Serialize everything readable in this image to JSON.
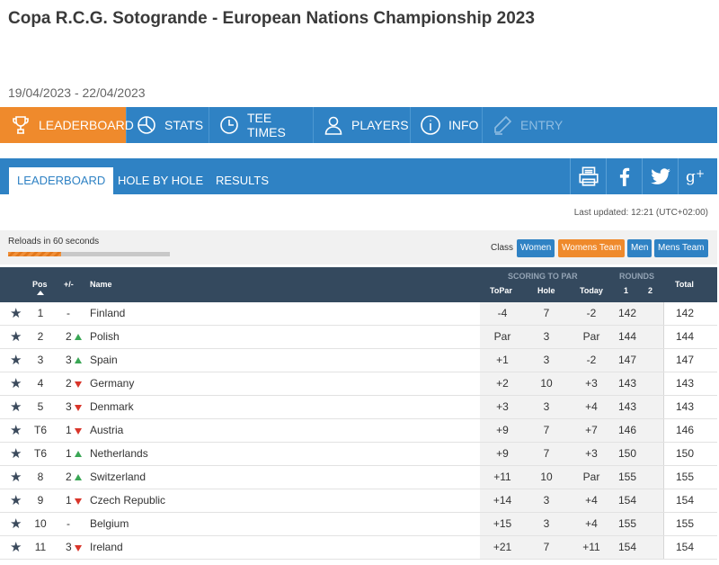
{
  "header": {
    "title": "Copa R.C.G. Sotogrande - European Nations Championship 2023",
    "dates": "19/04/2023 - 22/04/2023"
  },
  "main_nav": [
    {
      "label": "LEADERBOARD",
      "icon": "trophy-icon",
      "active": true
    },
    {
      "label": "STATS",
      "icon": "pie-chart-icon"
    },
    {
      "label": "TEE TIMES",
      "icon": "clock-icon"
    },
    {
      "label": "PLAYERS",
      "icon": "person-icon"
    },
    {
      "label": "INFO",
      "icon": "info-icon"
    },
    {
      "label": "ENTRY",
      "icon": "pen-icon",
      "disabled": true
    }
  ],
  "sub_nav": {
    "tabs": [
      "LEADERBOARD",
      "HOLE BY HOLE",
      "RESULTS"
    ],
    "share_icons": [
      "printer-icon",
      "facebook-icon",
      "twitter-icon",
      "google-plus-icon"
    ]
  },
  "last_updated": "Last updated: 12:21 (UTC+02:00)",
  "reload": {
    "text": "Reloads in 60 seconds",
    "progress": 0.33
  },
  "class_filter": {
    "label": "Class",
    "options": [
      {
        "label": "Women",
        "active": false
      },
      {
        "label": "Womens Team",
        "active": true
      },
      {
        "label": "Men",
        "active": false
      },
      {
        "label": "Mens Team",
        "active": false
      }
    ]
  },
  "table": {
    "headers": {
      "pos": "Pos",
      "change": "+/-",
      "name": "Name",
      "scoring_group": "SCORING TO PAR",
      "topar": "ToPar",
      "hole": "Hole",
      "today": "Today",
      "rounds_group": "ROUNDS",
      "r1": "1",
      "r2": "2",
      "total": "Total"
    },
    "rows": [
      {
        "pos": "1",
        "change": "-",
        "trend": "",
        "name": "Finland",
        "topar": "-4",
        "hole": "7",
        "today": "-2",
        "r1": "142",
        "r2": "",
        "total": "142"
      },
      {
        "pos": "2",
        "change": "2",
        "trend": "up",
        "name": "Polish",
        "topar": "Par",
        "hole": "3",
        "today": "Par",
        "r1": "144",
        "r2": "",
        "total": "144"
      },
      {
        "pos": "3",
        "change": "3",
        "trend": "up",
        "name": "Spain",
        "topar": "+1",
        "hole": "3",
        "today": "-2",
        "r1": "147",
        "r2": "",
        "total": "147"
      },
      {
        "pos": "4",
        "change": "2",
        "trend": "down",
        "name": "Germany",
        "topar": "+2",
        "hole": "10",
        "today": "+3",
        "r1": "143",
        "r2": "",
        "total": "143"
      },
      {
        "pos": "5",
        "change": "3",
        "trend": "down",
        "name": "Denmark",
        "topar": "+3",
        "hole": "3",
        "today": "+4",
        "r1": "143",
        "r2": "",
        "total": "143"
      },
      {
        "pos": "T6",
        "change": "1",
        "trend": "down",
        "name": "Austria",
        "topar": "+9",
        "hole": "7",
        "today": "+7",
        "r1": "146",
        "r2": "",
        "total": "146"
      },
      {
        "pos": "T6",
        "change": "1",
        "trend": "up",
        "name": "Netherlands",
        "topar": "+9",
        "hole": "7",
        "today": "+3",
        "r1": "150",
        "r2": "",
        "total": "150"
      },
      {
        "pos": "8",
        "change": "2",
        "trend": "up",
        "name": "Switzerland",
        "topar": "+11",
        "hole": "10",
        "today": "Par",
        "r1": "155",
        "r2": "",
        "total": "155"
      },
      {
        "pos": "9",
        "change": "1",
        "trend": "down",
        "name": "Czech Republic",
        "topar": "+14",
        "hole": "3",
        "today": "+4",
        "r1": "154",
        "r2": "",
        "total": "154"
      },
      {
        "pos": "10",
        "change": "-",
        "trend": "",
        "name": "Belgium",
        "topar": "+15",
        "hole": "3",
        "today": "+4",
        "r1": "155",
        "r2": "",
        "total": "155"
      },
      {
        "pos": "11",
        "change": "3",
        "trend": "down",
        "name": "Ireland",
        "topar": "+21",
        "hole": "7",
        "today": "+11",
        "r1": "154",
        "r2": "",
        "total": "154"
      }
    ]
  },
  "colors": {
    "nav_blue": "#2f82c4",
    "accent_orange": "#ef8a2c",
    "header_dark": "#34495e",
    "up_green": "#3aa655",
    "down_red": "#d9352a"
  }
}
